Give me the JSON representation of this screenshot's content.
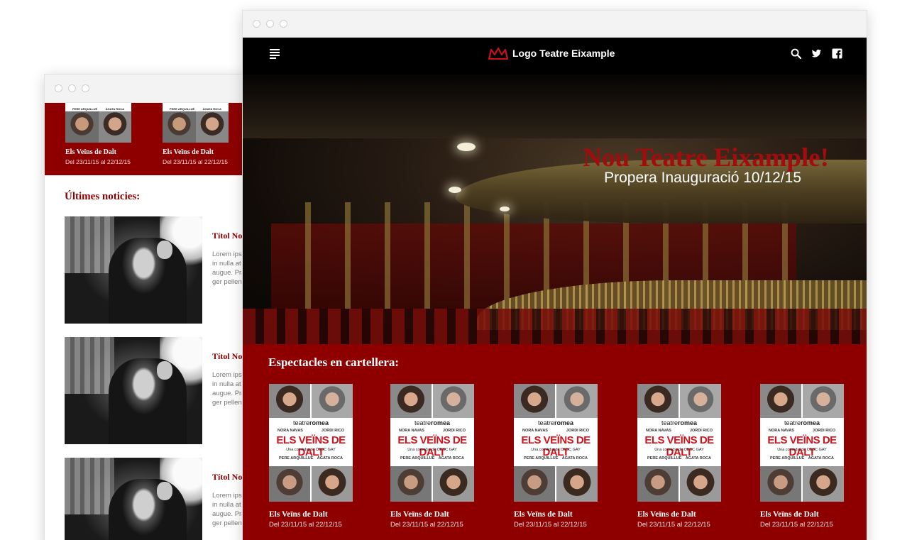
{
  "brand": {
    "logo_text": "Logo Teatre Eixample",
    "accent": "#8e0000",
    "title_red": "#a30c0c"
  },
  "nav": {
    "menu_icon": "hamburger-icon",
    "icons": [
      "search-icon",
      "twitter-icon",
      "facebook-icon"
    ]
  },
  "hero": {
    "title": "Nou Teatre Eixample!",
    "subtitle": "Propera Inauguració 10/12/15"
  },
  "shows": {
    "heading": "Espectacles en cartellera:",
    "poster": {
      "brand_a": "teatre",
      "brand_b": "romea",
      "actor_1": "NORA NAVAS",
      "actor_2": "JORDI RICO",
      "play": "ELS VEÏNS DE DALT",
      "comedy": "Una comèdia de CESC GAY",
      "actor_3": "PERE ARQUILLUÉ",
      "actor_4": "ÀGATA ROCA"
    },
    "items": [
      {
        "title": "Els Veïns de Dalt",
        "dates": "Del 23/11/15 al 22/12/15"
      },
      {
        "title": "Els Veïns de Dalt",
        "dates": "Del 23/11/15 al 22/12/15"
      },
      {
        "title": "Els Veïns de Dalt",
        "dates": "Del 23/11/15 al 22/12/15"
      },
      {
        "title": "Els Veïns de Dalt",
        "dates": "Del 23/11/15 al 22/12/15"
      },
      {
        "title": "Els Veïns de Dalt",
        "dates": "Del 23/11/15 al 22/12/15"
      }
    ]
  },
  "mobile": {
    "top_items": [
      {
        "title": "Els Veïns de Dalt",
        "dates": "Del 23/11/15 al 22/12/15",
        "actor_a": "PERE ARQUILLUÉ",
        "actor_b": "ÀGATA ROCA"
      },
      {
        "title": "Els Veïns de Dalt",
        "dates": "Del 23/11/15 al 22/12/15",
        "actor_a": "PERE ARQUILLUÉ",
        "actor_b": "ÀGATA ROCA"
      }
    ],
    "news_heading": "Últimes noticies:",
    "news": [
      {
        "title": "Títol No",
        "lines": [
          "Lorem ipsu",
          "in nulla at",
          "augue. Pra",
          "ger pellent"
        ]
      },
      {
        "title": "Títol No",
        "lines": [
          "Lorem ipsu",
          "in nulla at",
          "augue. Pra",
          "ger pellent"
        ]
      },
      {
        "title": "Títol No",
        "lines": [
          "Lorem ipsu",
          "in nulla at",
          "augue. Pra",
          "ger pellent"
        ]
      }
    ]
  }
}
